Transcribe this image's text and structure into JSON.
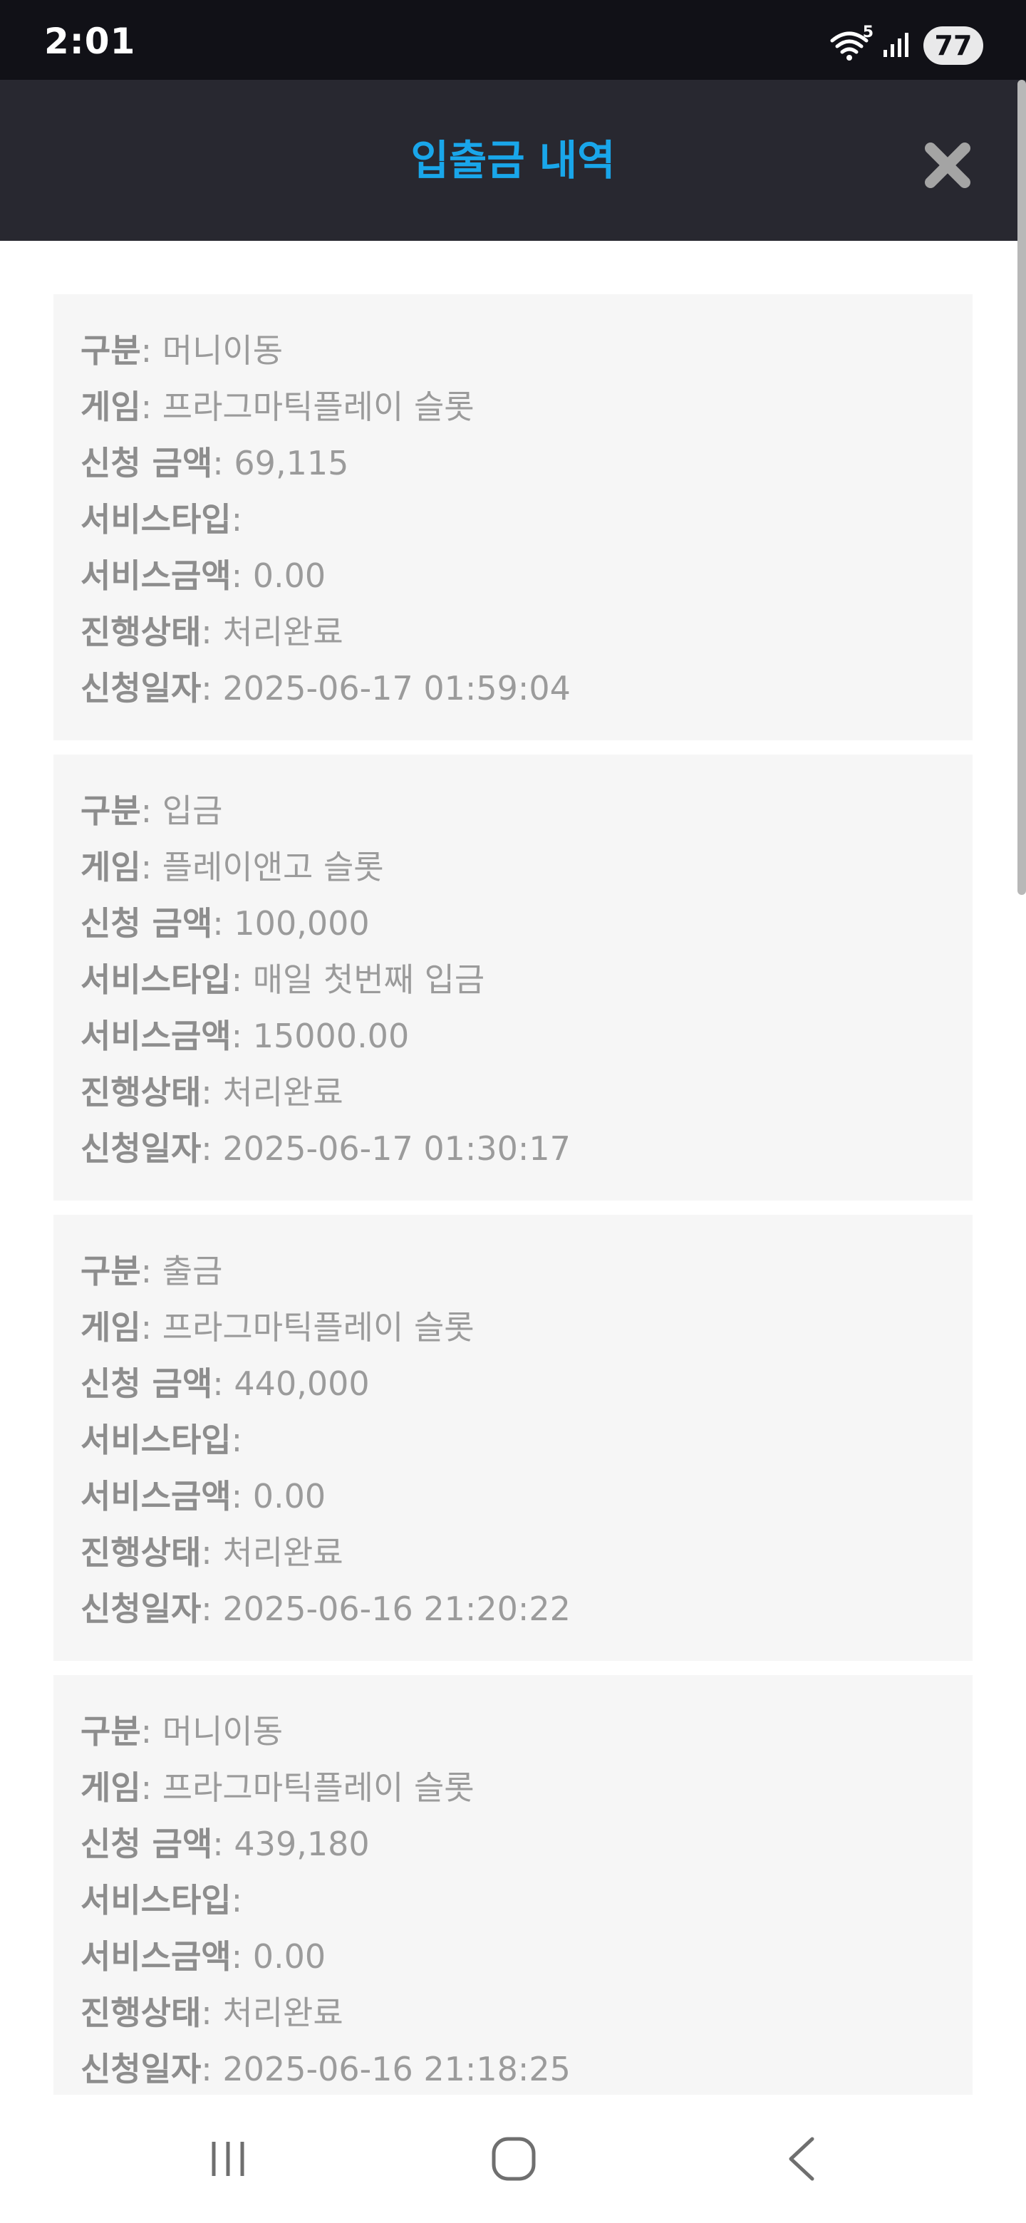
{
  "status_bar": {
    "time": "2:01",
    "battery": "77",
    "wifi_badge": "5",
    "icons": [
      "wifi-icon",
      "signal-icon",
      "battery-icon"
    ]
  },
  "header": {
    "title": "입출금 내역",
    "close_icon": "close-icon",
    "title_color": "#19a6ea"
  },
  "labels": {
    "category": "구분",
    "game": "게임",
    "amount": "신청 금액",
    "service_type": "서비스타입",
    "service_amount": "서비스금액",
    "status": "진행상태",
    "date": "신청일자"
  },
  "records": [
    {
      "category": ": 머니이동",
      "game": ": 프라그마틱플레이 슬롯",
      "amount": ": 69,115",
      "service_type": ":",
      "service_amount": ": 0.00",
      "status": ": 처리완료",
      "date": ": 2025-06-17 01:59:04"
    },
    {
      "category": ": 입금",
      "game": ": 플레이앤고 슬롯",
      "amount": ": 100,000",
      "service_type": ": 매일 첫번째 입금",
      "service_amount": ": 15000.00",
      "status": ": 처리완료",
      "date": ": 2025-06-17 01:30:17"
    },
    {
      "category": ": 출금",
      "game": ": 프라그마틱플레이 슬롯",
      "amount": ": 440,000",
      "service_type": ":",
      "service_amount": ": 0.00",
      "status": ": 처리완료",
      "date": ": 2025-06-16 21:20:22"
    },
    {
      "category": ": 머니이동",
      "game": ": 프라그마틱플레이 슬롯",
      "amount": ": 439,180",
      "service_type": ":",
      "service_amount": ": 0.00",
      "status": ": 처리완료",
      "date": ": 2025-06-16 21:18:25"
    }
  ],
  "nav_bar": {
    "icons": [
      "recents-icon",
      "home-icon",
      "back-icon"
    ]
  }
}
